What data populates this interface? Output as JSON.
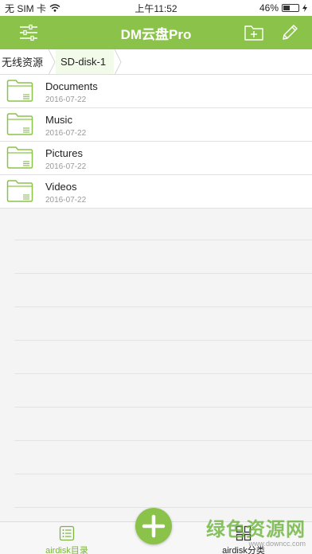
{
  "status_bar": {
    "carrier": "无 SIM 卡",
    "time": "上午11:52",
    "battery": "46%",
    "battery_level": 0.46
  },
  "header": {
    "title": "DM云盘Pro",
    "color": "#8bc34a"
  },
  "breadcrumb": [
    {
      "label": "无线资源"
    },
    {
      "label": "SD-disk-1"
    }
  ],
  "files": [
    {
      "name": "Documents",
      "date": "2016-07-22",
      "icon": "folder-icon"
    },
    {
      "name": "Music",
      "date": "2016-07-22",
      "icon": "folder-icon"
    },
    {
      "name": "Pictures",
      "date": "2016-07-22",
      "icon": "folder-icon"
    },
    {
      "name": "Videos",
      "date": "2016-07-22",
      "icon": "folder-icon"
    }
  ],
  "tabs": [
    {
      "label": "airdisk目录",
      "icon": "list-icon",
      "active": true
    },
    {
      "label": "airdisk分类",
      "icon": "grid-icon",
      "active": false
    }
  ],
  "watermark": {
    "main": "绿色资源网",
    "sub": "www.downcc.com"
  }
}
